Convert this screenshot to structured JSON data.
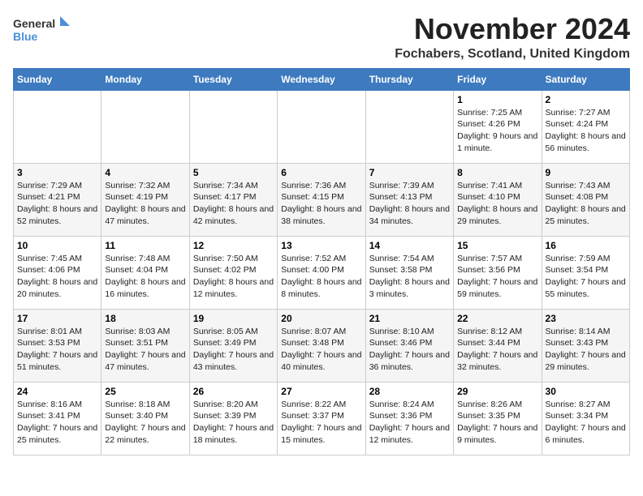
{
  "logo": {
    "general": "General",
    "blue": "Blue"
  },
  "title": "November 2024",
  "location": "Fochabers, Scotland, United Kingdom",
  "headers": [
    "Sunday",
    "Monday",
    "Tuesday",
    "Wednesday",
    "Thursday",
    "Friday",
    "Saturday"
  ],
  "weeks": [
    [
      {
        "day": "",
        "info": ""
      },
      {
        "day": "",
        "info": ""
      },
      {
        "day": "",
        "info": ""
      },
      {
        "day": "",
        "info": ""
      },
      {
        "day": "",
        "info": ""
      },
      {
        "day": "1",
        "info": "Sunrise: 7:25 AM\nSunset: 4:26 PM\nDaylight: 9 hours and 1 minute."
      },
      {
        "day": "2",
        "info": "Sunrise: 7:27 AM\nSunset: 4:24 PM\nDaylight: 8 hours and 56 minutes."
      }
    ],
    [
      {
        "day": "3",
        "info": "Sunrise: 7:29 AM\nSunset: 4:21 PM\nDaylight: 8 hours and 52 minutes."
      },
      {
        "day": "4",
        "info": "Sunrise: 7:32 AM\nSunset: 4:19 PM\nDaylight: 8 hours and 47 minutes."
      },
      {
        "day": "5",
        "info": "Sunrise: 7:34 AM\nSunset: 4:17 PM\nDaylight: 8 hours and 42 minutes."
      },
      {
        "day": "6",
        "info": "Sunrise: 7:36 AM\nSunset: 4:15 PM\nDaylight: 8 hours and 38 minutes."
      },
      {
        "day": "7",
        "info": "Sunrise: 7:39 AM\nSunset: 4:13 PM\nDaylight: 8 hours and 34 minutes."
      },
      {
        "day": "8",
        "info": "Sunrise: 7:41 AM\nSunset: 4:10 PM\nDaylight: 8 hours and 29 minutes."
      },
      {
        "day": "9",
        "info": "Sunrise: 7:43 AM\nSunset: 4:08 PM\nDaylight: 8 hours and 25 minutes."
      }
    ],
    [
      {
        "day": "10",
        "info": "Sunrise: 7:45 AM\nSunset: 4:06 PM\nDaylight: 8 hours and 20 minutes."
      },
      {
        "day": "11",
        "info": "Sunrise: 7:48 AM\nSunset: 4:04 PM\nDaylight: 8 hours and 16 minutes."
      },
      {
        "day": "12",
        "info": "Sunrise: 7:50 AM\nSunset: 4:02 PM\nDaylight: 8 hours and 12 minutes."
      },
      {
        "day": "13",
        "info": "Sunrise: 7:52 AM\nSunset: 4:00 PM\nDaylight: 8 hours and 8 minutes."
      },
      {
        "day": "14",
        "info": "Sunrise: 7:54 AM\nSunset: 3:58 PM\nDaylight: 8 hours and 3 minutes."
      },
      {
        "day": "15",
        "info": "Sunrise: 7:57 AM\nSunset: 3:56 PM\nDaylight: 7 hours and 59 minutes."
      },
      {
        "day": "16",
        "info": "Sunrise: 7:59 AM\nSunset: 3:54 PM\nDaylight: 7 hours and 55 minutes."
      }
    ],
    [
      {
        "day": "17",
        "info": "Sunrise: 8:01 AM\nSunset: 3:53 PM\nDaylight: 7 hours and 51 minutes."
      },
      {
        "day": "18",
        "info": "Sunrise: 8:03 AM\nSunset: 3:51 PM\nDaylight: 7 hours and 47 minutes."
      },
      {
        "day": "19",
        "info": "Sunrise: 8:05 AM\nSunset: 3:49 PM\nDaylight: 7 hours and 43 minutes."
      },
      {
        "day": "20",
        "info": "Sunrise: 8:07 AM\nSunset: 3:48 PM\nDaylight: 7 hours and 40 minutes."
      },
      {
        "day": "21",
        "info": "Sunrise: 8:10 AM\nSunset: 3:46 PM\nDaylight: 7 hours and 36 minutes."
      },
      {
        "day": "22",
        "info": "Sunrise: 8:12 AM\nSunset: 3:44 PM\nDaylight: 7 hours and 32 minutes."
      },
      {
        "day": "23",
        "info": "Sunrise: 8:14 AM\nSunset: 3:43 PM\nDaylight: 7 hours and 29 minutes."
      }
    ],
    [
      {
        "day": "24",
        "info": "Sunrise: 8:16 AM\nSunset: 3:41 PM\nDaylight: 7 hours and 25 minutes."
      },
      {
        "day": "25",
        "info": "Sunrise: 8:18 AM\nSunset: 3:40 PM\nDaylight: 7 hours and 22 minutes."
      },
      {
        "day": "26",
        "info": "Sunrise: 8:20 AM\nSunset: 3:39 PM\nDaylight: 7 hours and 18 minutes."
      },
      {
        "day": "27",
        "info": "Sunrise: 8:22 AM\nSunset: 3:37 PM\nDaylight: 7 hours and 15 minutes."
      },
      {
        "day": "28",
        "info": "Sunrise: 8:24 AM\nSunset: 3:36 PM\nDaylight: 7 hours and 12 minutes."
      },
      {
        "day": "29",
        "info": "Sunrise: 8:26 AM\nSunset: 3:35 PM\nDaylight: 7 hours and 9 minutes."
      },
      {
        "day": "30",
        "info": "Sunrise: 8:27 AM\nSunset: 3:34 PM\nDaylight: 7 hours and 6 minutes."
      }
    ]
  ]
}
